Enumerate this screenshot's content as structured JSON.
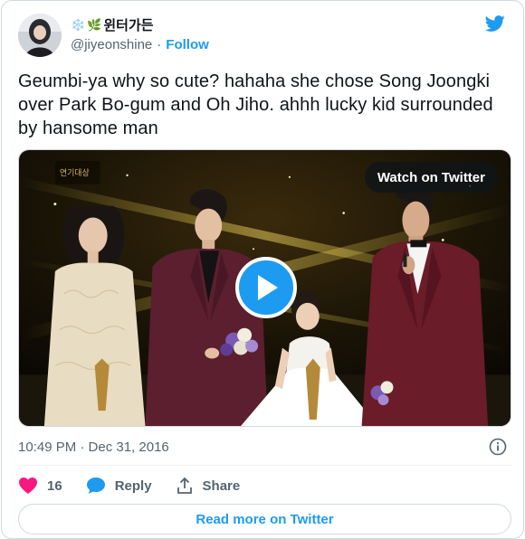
{
  "tweet": {
    "display_name": "윈터가든",
    "name_emoji": [
      "❄️",
      "🌿"
    ],
    "handle": "@jiyeonshine",
    "follow_label": "Follow",
    "separator": "·",
    "text": "Geumbi-ya why so cute? hahaha she chose Song Joongki over Park Bo-gum and Oh Jiho. ahhh lucky kid surrounded by hansome man",
    "timestamp": "10:49 PM · Dec 31, 2016"
  },
  "media": {
    "watch_label": "Watch on Twitter",
    "logo_text": "연기대상"
  },
  "actions": {
    "like_count": "16",
    "reply_label": "Reply",
    "share_label": "Share"
  },
  "read_more_label": "Read more on Twitter",
  "colors": {
    "accent": "#1d9bf0",
    "like": "#f91880",
    "text": "#0f1419",
    "muted": "#536471"
  }
}
